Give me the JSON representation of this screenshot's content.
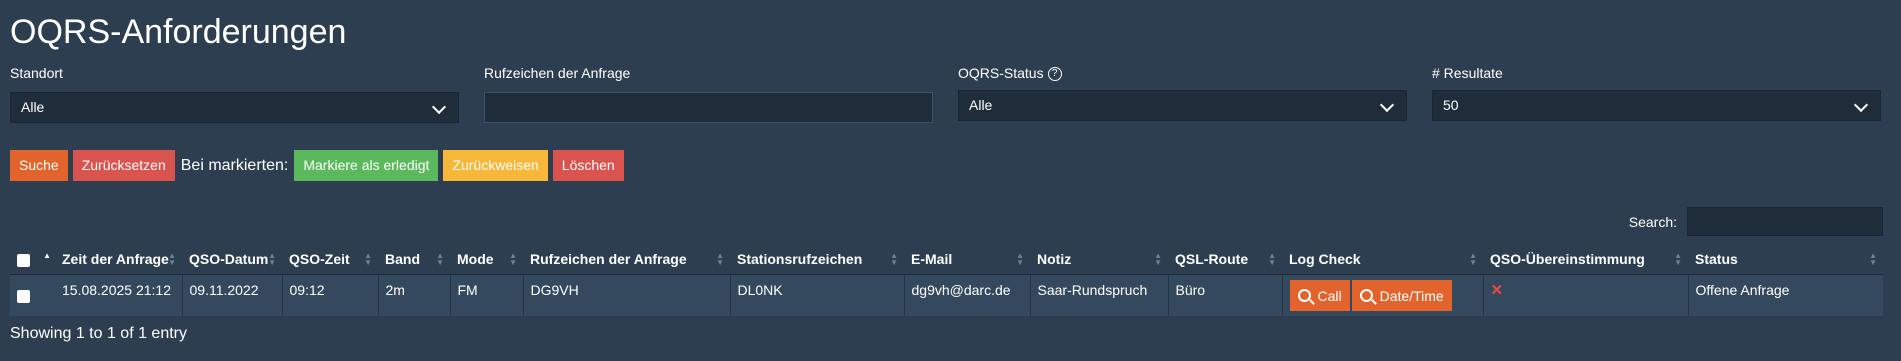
{
  "page": {
    "title": "OQRS-Anforderungen"
  },
  "filters": {
    "standort": {
      "label": "Standort",
      "value": "Alle"
    },
    "callsign": {
      "label": "Rufzeichen der Anfrage",
      "value": ""
    },
    "status": {
      "label": "OQRS-Status",
      "value": "Alle"
    },
    "results": {
      "label": "# Resultate",
      "value": "50"
    }
  },
  "actions": {
    "search": "Suche",
    "reset": "Zurücksetzen",
    "marked_label": "Bei markierten:",
    "mark_done": "Markiere als erledigt",
    "reject": "Zurückweisen",
    "delete": "Löschen"
  },
  "table_search": {
    "label": "Search:",
    "value": ""
  },
  "table": {
    "headers": [
      "Zeit der Anfrage",
      "QSO-Datum",
      "QSO-Zeit",
      "Band",
      "Mode",
      "Rufzeichen der Anfrage",
      "Stationsrufzeichen",
      "E-Mail",
      "Notiz",
      "QSL-Route",
      "Log Check",
      "QSO-Übereinstimmung",
      "Status"
    ],
    "rows": [
      {
        "time": "15.08.2025 21:12",
        "qso_date": "09.11.2022",
        "qso_time": "09:12",
        "band": "2m",
        "mode": "FM",
        "callsign": "DG9VH",
        "station": "DL0NK",
        "email": "dg9vh@darc.de",
        "note": "Saar-Rundspruch",
        "qsl_route": "Büro",
        "btn_call": "Call",
        "btn_datetime": "Date/Time",
        "match_icon": "x-icon",
        "status": "Offene Anfrage"
      }
    ]
  },
  "footer": {
    "info": "Showing 1 to 1 of 1 entry"
  },
  "colors": {
    "background": "#2c3e50",
    "primary": "#e2632b",
    "danger": "#d9534f",
    "success": "#5cb85c",
    "warning": "#f7b739"
  }
}
